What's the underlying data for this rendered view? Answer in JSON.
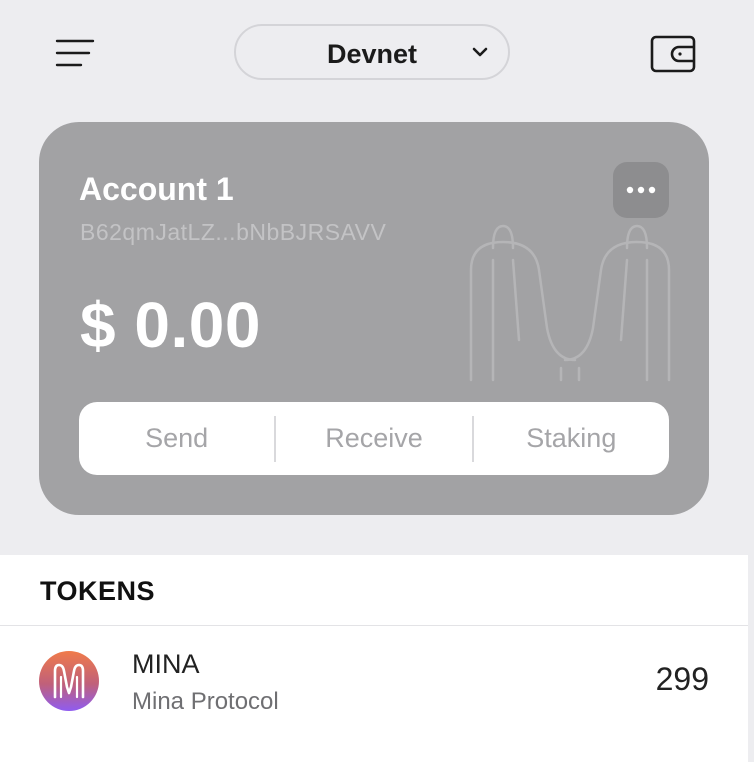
{
  "header": {
    "menu_icon": "hamburger-menu-icon",
    "network": {
      "selected": "Devnet",
      "chevron_icon": "chevron-down-icon"
    },
    "wallet_icon": "wallet-icon"
  },
  "account": {
    "name": "Account 1",
    "address": "B62qmJatLZ...bNbBJRSAVV",
    "balance": "$ 0.00",
    "more_icon": "more-horizontal-icon",
    "watermark_icon": "mina-logo-watermark"
  },
  "actions": [
    {
      "label": "Send"
    },
    {
      "label": "Receive"
    },
    {
      "label": "Staking"
    }
  ],
  "tokens": {
    "heading": "TOKENS",
    "items": [
      {
        "symbol": "MINA",
        "name": "Mina Protocol",
        "amount": "299",
        "icon": "mina-token-icon"
      }
    ]
  },
  "colors": {
    "background": "#ededf0",
    "card": "#a2a2a4",
    "token_gradient_top": "#f07b4a",
    "token_gradient_bottom": "#8f5cf0"
  }
}
